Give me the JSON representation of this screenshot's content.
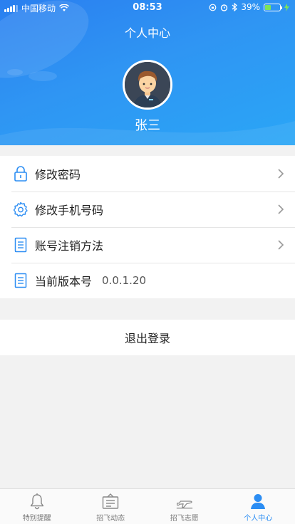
{
  "status_bar": {
    "carrier": "中国移动",
    "time": "08:53",
    "battery_percent": "39%",
    "battery_level": 0.39
  },
  "header": {
    "title": "个人中心",
    "username": "张三",
    "gradient_colors": [
      "#2a7ff0",
      "#2aa6f6"
    ]
  },
  "menu": {
    "items": [
      {
        "label": "修改密码",
        "icon": "lock-icon",
        "has_chevron": true
      },
      {
        "label": "修改手机号码",
        "icon": "gear-icon",
        "has_chevron": true
      },
      {
        "label": "账号注销方法",
        "icon": "document-icon",
        "has_chevron": true
      },
      {
        "label": "当前版本号",
        "value": "0.0.1.20",
        "icon": "document-icon",
        "has_chevron": false
      }
    ]
  },
  "logout_label": "退出登录",
  "tabbar": {
    "active_color": "#2b8df3",
    "items": [
      {
        "label": "特别提醒",
        "icon": "bell-icon",
        "active": false
      },
      {
        "label": "招飞动态",
        "icon": "signboard-icon",
        "active": false
      },
      {
        "label": "招飞志愿",
        "icon": "airplane-icon",
        "active": false
      },
      {
        "label": "个人中心",
        "icon": "person-icon",
        "active": true
      }
    ]
  }
}
